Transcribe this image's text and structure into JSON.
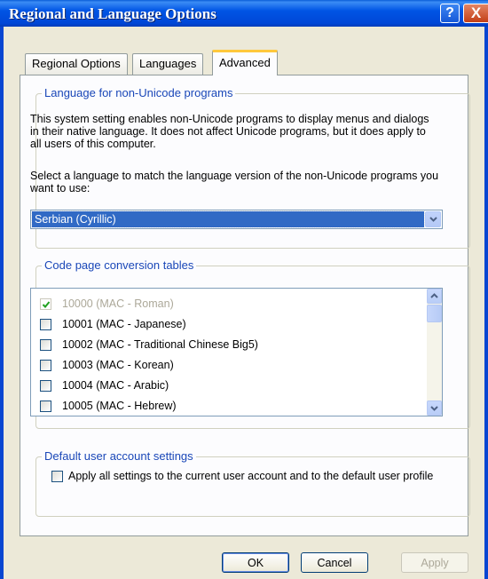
{
  "window": {
    "title": "Regional and Language Options",
    "help_label": "?",
    "close_label": "X"
  },
  "tabs": [
    {
      "label": "Regional Options",
      "active": false
    },
    {
      "label": "Languages",
      "active": false
    },
    {
      "label": "Advanced",
      "active": true
    }
  ],
  "non_unicode": {
    "group_title": "Language for non-Unicode programs",
    "description": "This system setting enables non-Unicode programs to display menus and dialogs in their native language. It does not affect Unicode programs, but it does apply to all users of this computer.",
    "prompt": "Select a language to match the language version of the non-Unicode programs you want to use:",
    "selected_language": "Serbian (Cyrillic)"
  },
  "code_pages": {
    "group_title": "Code page conversion tables",
    "items": [
      {
        "label": "10000 (MAC - Roman)",
        "checked": true,
        "disabled": true
      },
      {
        "label": "10001 (MAC - Japanese)",
        "checked": false,
        "disabled": false
      },
      {
        "label": "10002 (MAC - Traditional Chinese Big5)",
        "checked": false,
        "disabled": false
      },
      {
        "label": "10003 (MAC - Korean)",
        "checked": false,
        "disabled": false
      },
      {
        "label": "10004 (MAC - Arabic)",
        "checked": false,
        "disabled": false
      },
      {
        "label": "10005 (MAC - Hebrew)",
        "checked": false,
        "disabled": false
      }
    ]
  },
  "default_user": {
    "group_title": "Default user account settings",
    "checkbox_label": "Apply all settings to the current user account and to the default user profile",
    "checked": false
  },
  "buttons": {
    "ok": "OK",
    "cancel": "Cancel",
    "apply": "Apply"
  },
  "colors": {
    "title_bar": "#0055e5",
    "group_title": "#1a47b8",
    "selection": "#316ac5",
    "disabled_text": "#aca899"
  }
}
